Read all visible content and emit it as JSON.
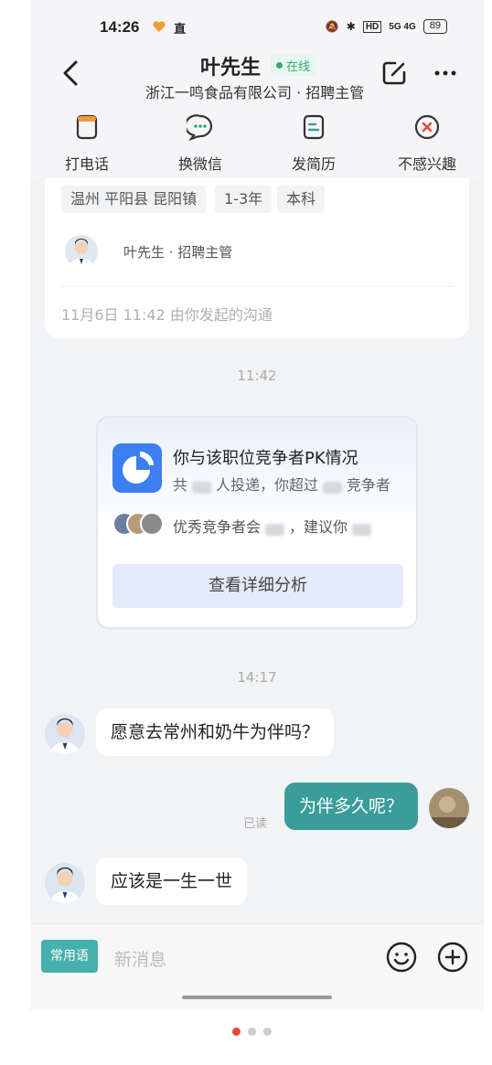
{
  "status_bar": {
    "time": "14:26",
    "extra": "直",
    "network": "5G 4G",
    "battery": "89"
  },
  "header": {
    "name": "叶先生",
    "online": "在线",
    "company": "浙江一鸣食品有限公司 · 招聘主管"
  },
  "actions": [
    {
      "label": "打电话",
      "icon": "phone-icon"
    },
    {
      "label": "换微信",
      "icon": "wechat-icon"
    },
    {
      "label": "发简历",
      "icon": "resume-icon"
    },
    {
      "label": "不感兴趣",
      "icon": "not-interested-icon"
    }
  ],
  "job_card": {
    "tags": [
      "温州 平阳县 昆阳镇",
      "1-3年",
      "本科"
    ],
    "recruiter": "叶先生 · 招聘主管",
    "start_info": "11月6日 11:42 由你发起的沟通"
  },
  "timestamps": {
    "first": "11:42",
    "second": "14:17"
  },
  "pk_card": {
    "title": "你与该职位竞争者PK情况",
    "sub_prefix": "共",
    "sub_mid": "人投递，你超过",
    "sub_suffix": "竞争者",
    "suggest_prefix": "优秀竞争者会",
    "suggest_mid": "，建议你",
    "button": "查看详细分析",
    "colors": {
      "accent": "#3d7ef0"
    }
  },
  "messages": [
    {
      "side": "left",
      "text": "愿意去常州和奶牛为伴吗？"
    },
    {
      "side": "right",
      "text": "为伴多久呢？",
      "status": "已读"
    },
    {
      "side": "left",
      "text": "应该是一生一世"
    }
  ],
  "input_bar": {
    "phrase_button": "常用语",
    "placeholder": "新消息"
  },
  "colors": {
    "primary": "#3b9d9a",
    "online": "#2fae6f"
  }
}
